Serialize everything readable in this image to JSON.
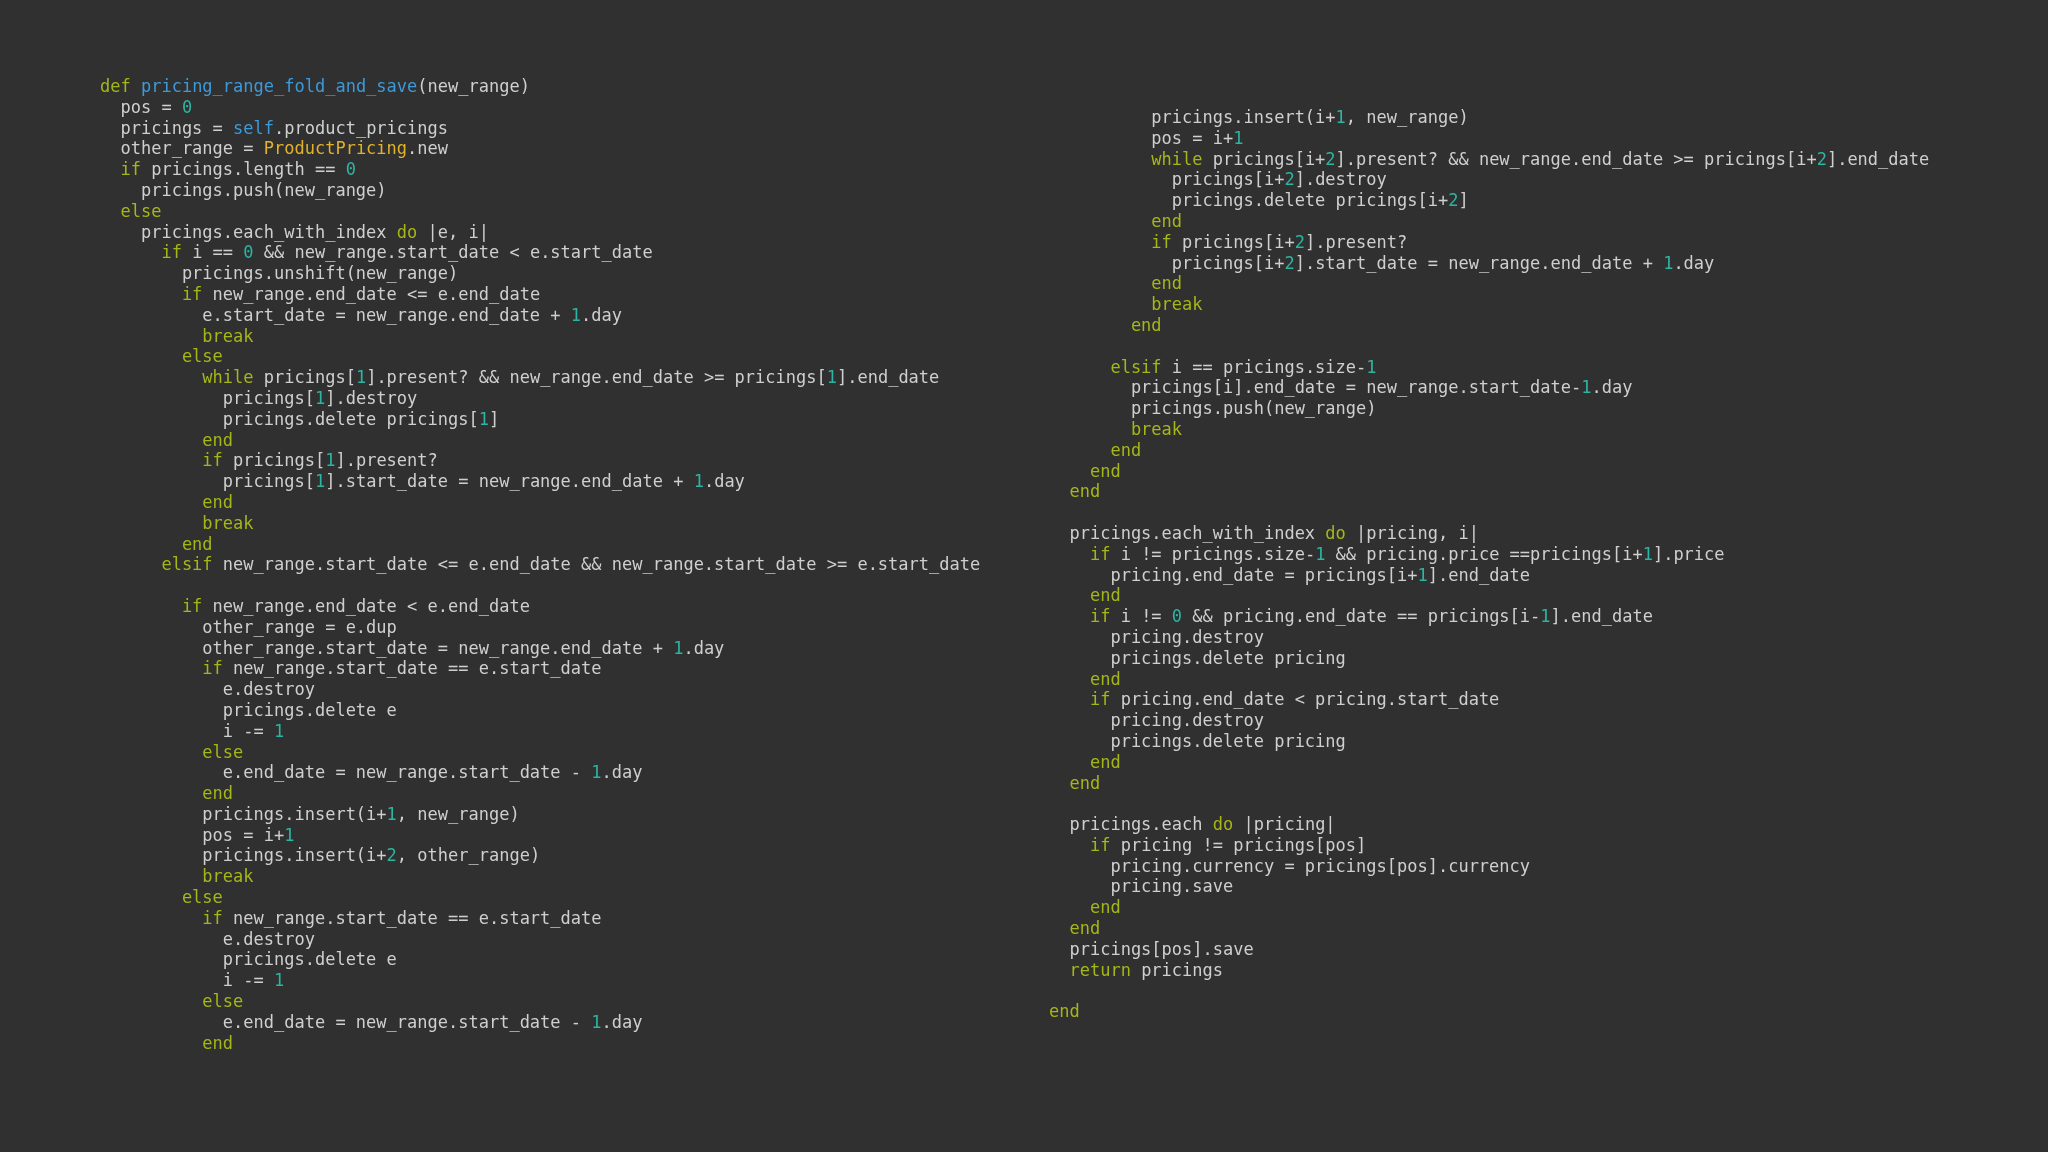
{
  "code_columns": [
    {
      "blocks": [
        [
          [
            {
              "kind": "keyword",
              "text": "def "
            },
            {
              "kind": "function",
              "text": "pricing_range_fold_and_save"
            },
            "(new_range)"
          ],
          [
            "  pos = ",
            {
              "kind": "number",
              "text": "0"
            }
          ],
          [
            "  pricings = ",
            {
              "kind": "self",
              "text": "self"
            },
            ".product_pricings"
          ],
          [
            "  other_range = ",
            {
              "kind": "constant",
              "text": "ProductPricing"
            },
            ".new"
          ],
          [
            {
              "kind": "keyword",
              "text": "  if"
            },
            " pricings.length == ",
            {
              "kind": "number",
              "text": "0"
            }
          ],
          [
            "    pricings.push(new_range)"
          ],
          [
            {
              "kind": "keyword",
              "text": "  else"
            }
          ],
          [
            "    pricings.each_with_index ",
            {
              "kind": "keyword",
              "text": "do"
            },
            " |e, i|"
          ],
          [
            {
              "kind": "keyword",
              "text": "      if"
            },
            " i == ",
            {
              "kind": "number",
              "text": "0"
            },
            " && new_range.start_date < e.start_date"
          ],
          [
            "        pricings.unshift(new_range)"
          ],
          [
            {
              "kind": "keyword",
              "text": "        if"
            },
            " new_range.end_date <= e.end_date"
          ],
          [
            "          e.start_date = new_range.end_date + ",
            {
              "kind": "number",
              "text": "1"
            },
            ".day"
          ],
          [
            {
              "kind": "keyword",
              "text": "          break"
            }
          ],
          [
            {
              "kind": "keyword",
              "text": "        else"
            }
          ],
          [
            {
              "kind": "keyword",
              "text": "          while"
            },
            " pricings[",
            {
              "kind": "number",
              "text": "1"
            },
            "].present? && new_range.end_date >= pricings[",
            {
              "kind": "number",
              "text": "1"
            },
            "].end_date"
          ],
          [
            "            pricings[",
            {
              "kind": "number",
              "text": "1"
            },
            "].destroy"
          ],
          [
            "            pricings.delete pricings[",
            {
              "kind": "number",
              "text": "1"
            },
            "]"
          ],
          [
            {
              "kind": "keyword",
              "text": "          end"
            }
          ],
          [
            {
              "kind": "keyword",
              "text": "          if"
            },
            " pricings[",
            {
              "kind": "number",
              "text": "1"
            },
            "].present?"
          ],
          [
            "            pricings[",
            {
              "kind": "number",
              "text": "1"
            },
            "].start_date = new_range.end_date + ",
            {
              "kind": "number",
              "text": "1"
            },
            ".day"
          ],
          [
            {
              "kind": "keyword",
              "text": "          end"
            }
          ],
          [
            {
              "kind": "keyword",
              "text": "          break"
            }
          ],
          [
            {
              "kind": "keyword",
              "text": "        end"
            }
          ],
          [
            {
              "kind": "keyword",
              "text": "      elsif"
            },
            " new_range.start_date <= e.end_date && new_range.start_date >= e.start_date"
          ]
        ],
        [
          [
            {
              "kind": "keyword",
              "text": "        if"
            },
            " new_range.end_date < e.end_date"
          ],
          [
            "          other_range = e.dup"
          ],
          [
            "          other_range.start_date = new_range.end_date + ",
            {
              "kind": "number",
              "text": "1"
            },
            ".day"
          ],
          [
            {
              "kind": "keyword",
              "text": "          if"
            },
            " new_range.start_date == e.start_date"
          ],
          [
            "            e.destroy"
          ],
          [
            "            pricings.delete e"
          ],
          [
            "            i -= ",
            {
              "kind": "number",
              "text": "1"
            }
          ],
          [
            {
              "kind": "keyword",
              "text": "          else"
            }
          ],
          [
            "            e.end_date = new_range.start_date - ",
            {
              "kind": "number",
              "text": "1"
            },
            ".day"
          ],
          [
            {
              "kind": "keyword",
              "text": "          end"
            }
          ],
          [
            "          pricings.insert(i+",
            {
              "kind": "number",
              "text": "1"
            },
            ", new_range)"
          ],
          [
            "          pos = i+",
            {
              "kind": "number",
              "text": "1"
            }
          ],
          [
            "          pricings.insert(i+",
            {
              "kind": "number",
              "text": "2"
            },
            ", other_range)"
          ],
          [
            {
              "kind": "keyword",
              "text": "          break"
            }
          ],
          [
            {
              "kind": "keyword",
              "text": "        else"
            }
          ],
          [
            {
              "kind": "keyword",
              "text": "          if"
            },
            " new_range.start_date == e.start_date"
          ],
          [
            "            e.destroy"
          ],
          [
            "            pricings.delete e"
          ],
          [
            "            i -= ",
            {
              "kind": "number",
              "text": "1"
            }
          ],
          [
            {
              "kind": "keyword",
              "text": "          else"
            }
          ],
          [
            "            e.end_date = new_range.start_date - ",
            {
              "kind": "number",
              "text": "1"
            },
            ".day"
          ],
          [
            {
              "kind": "keyword",
              "text": "          end"
            }
          ]
        ]
      ]
    },
    {
      "blocks": [
        [
          [
            "          pricings.insert(i+",
            {
              "kind": "number",
              "text": "1"
            },
            ", new_range)"
          ],
          [
            "          pos = i+",
            {
              "kind": "number",
              "text": "1"
            }
          ],
          [
            {
              "kind": "keyword",
              "text": "          while"
            },
            " pricings[i+",
            {
              "kind": "number",
              "text": "2"
            },
            "].present? && new_range.end_date >= pricings[i+",
            {
              "kind": "number",
              "text": "2"
            },
            "].end_date"
          ],
          [
            "            pricings[i+",
            {
              "kind": "number",
              "text": "2"
            },
            "].destroy"
          ],
          [
            "            pricings.delete pricings[i+",
            {
              "kind": "number",
              "text": "2"
            },
            "]"
          ],
          [
            {
              "kind": "keyword",
              "text": "          end"
            }
          ],
          [
            {
              "kind": "keyword",
              "text": "          if"
            },
            " pricings[i+",
            {
              "kind": "number",
              "text": "2"
            },
            "].present?"
          ],
          [
            "            pricings[i+",
            {
              "kind": "number",
              "text": "2"
            },
            "].start_date = new_range.end_date + ",
            {
              "kind": "number",
              "text": "1"
            },
            ".day"
          ],
          [
            {
              "kind": "keyword",
              "text": "          end"
            }
          ],
          [
            {
              "kind": "keyword",
              "text": "          break"
            }
          ],
          [
            {
              "kind": "keyword",
              "text": "        end"
            }
          ]
        ],
        [
          [
            {
              "kind": "keyword",
              "text": "      elsif"
            },
            " i == pricings.size-",
            {
              "kind": "number",
              "text": "1"
            }
          ],
          [
            "        pricings[i].end_date = new_range.start_date-",
            {
              "kind": "number",
              "text": "1"
            },
            ".day"
          ],
          [
            "        pricings.push(new_range)"
          ],
          [
            {
              "kind": "keyword",
              "text": "        break"
            }
          ],
          [
            {
              "kind": "keyword",
              "text": "      end"
            }
          ],
          [
            {
              "kind": "keyword",
              "text": "    end"
            }
          ],
          [
            {
              "kind": "keyword",
              "text": "  end"
            }
          ]
        ],
        [
          [
            "  pricings.each_with_index ",
            {
              "kind": "keyword",
              "text": "do"
            },
            " |pricing, i|"
          ],
          [
            {
              "kind": "keyword",
              "text": "    if"
            },
            " i != pricings.size-",
            {
              "kind": "number",
              "text": "1"
            },
            " && pricing.price ==pricings[i+",
            {
              "kind": "number",
              "text": "1"
            },
            "].price"
          ],
          [
            "      pricing.end_date = pricings[i+",
            {
              "kind": "number",
              "text": "1"
            },
            "].end_date"
          ],
          [
            {
              "kind": "keyword",
              "text": "    end"
            }
          ],
          [
            {
              "kind": "keyword",
              "text": "    if"
            },
            " i != ",
            {
              "kind": "number",
              "text": "0"
            },
            " && pricing.end_date == pricings[i-",
            {
              "kind": "number",
              "text": "1"
            },
            "].end_date"
          ],
          [
            "      pricing.destroy"
          ],
          [
            "      pricings.delete pricing"
          ],
          [
            {
              "kind": "keyword",
              "text": "    end"
            }
          ],
          [
            {
              "kind": "keyword",
              "text": "    if"
            },
            " pricing.end_date < pricing.start_date"
          ],
          [
            "      pricing.destroy"
          ],
          [
            "      pricings.delete pricing"
          ],
          [
            {
              "kind": "keyword",
              "text": "    end"
            }
          ],
          [
            {
              "kind": "keyword",
              "text": "  end"
            }
          ]
        ],
        [
          [
            "  pricings.each ",
            {
              "kind": "keyword",
              "text": "do"
            },
            " |pricing|"
          ],
          [
            {
              "kind": "keyword",
              "text": "    if"
            },
            " pricing != pricings[pos]"
          ],
          [
            "      pricing.currency = pricings[pos].currency"
          ],
          [
            "      pricing.save"
          ],
          [
            {
              "kind": "keyword",
              "text": "    end"
            }
          ],
          [
            {
              "kind": "keyword",
              "text": "  end"
            }
          ],
          [
            "  pricings[pos].save"
          ],
          [
            {
              "kind": "keyword",
              "text": "  return"
            },
            " pricings"
          ]
        ],
        [
          [
            {
              "kind": "keyword",
              "text": "end"
            }
          ]
        ]
      ]
    }
  ]
}
